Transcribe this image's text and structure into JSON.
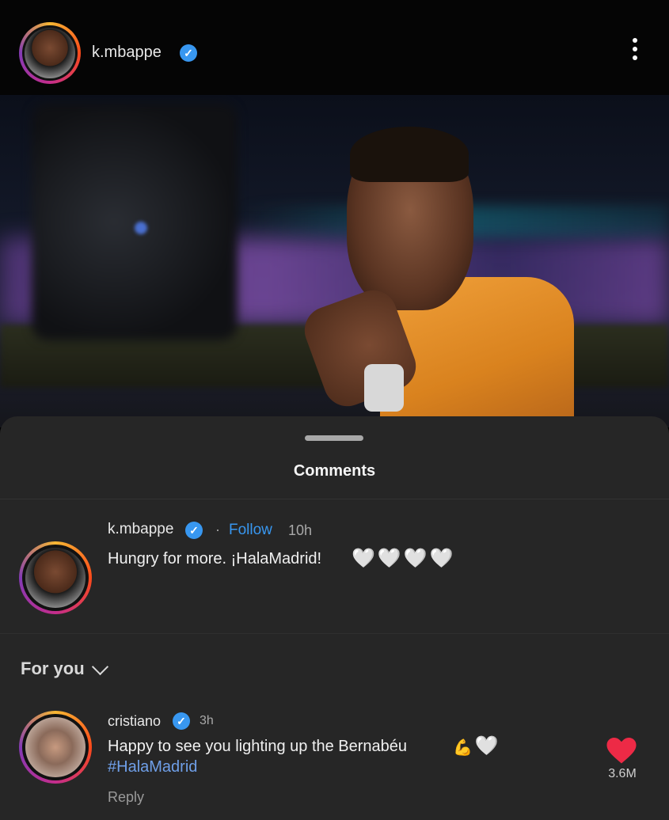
{
  "header": {
    "username": "k.mbappe",
    "verified_icon": "verified-badge-icon",
    "menu_icon": "more-options-icon"
  },
  "post_image": {
    "description_icon": "post-photo"
  },
  "comments_sheet": {
    "title": "Comments",
    "caption": {
      "username": "k.mbappe",
      "separator": "·",
      "follow_label": "Follow",
      "time": "10h",
      "text": "Hungry for more. ¡HalaMadrid!",
      "hearts": [
        "🤍",
        "🤍",
        "🤍",
        "🤍"
      ]
    },
    "filter": {
      "label": "For you"
    },
    "comments": [
      {
        "username": "cristiano",
        "time": "3h",
        "text": "Happy to see you lighting up the Bernabéu",
        "emoji": [
          "💪",
          "🤍"
        ],
        "hashtag": "#HalaMadrid",
        "reply_label": "Reply",
        "likes": "3.6M"
      }
    ]
  },
  "colors": {
    "accent": "#3897f0",
    "like_red": "#ed2a46",
    "sheet_bg": "#262626"
  }
}
